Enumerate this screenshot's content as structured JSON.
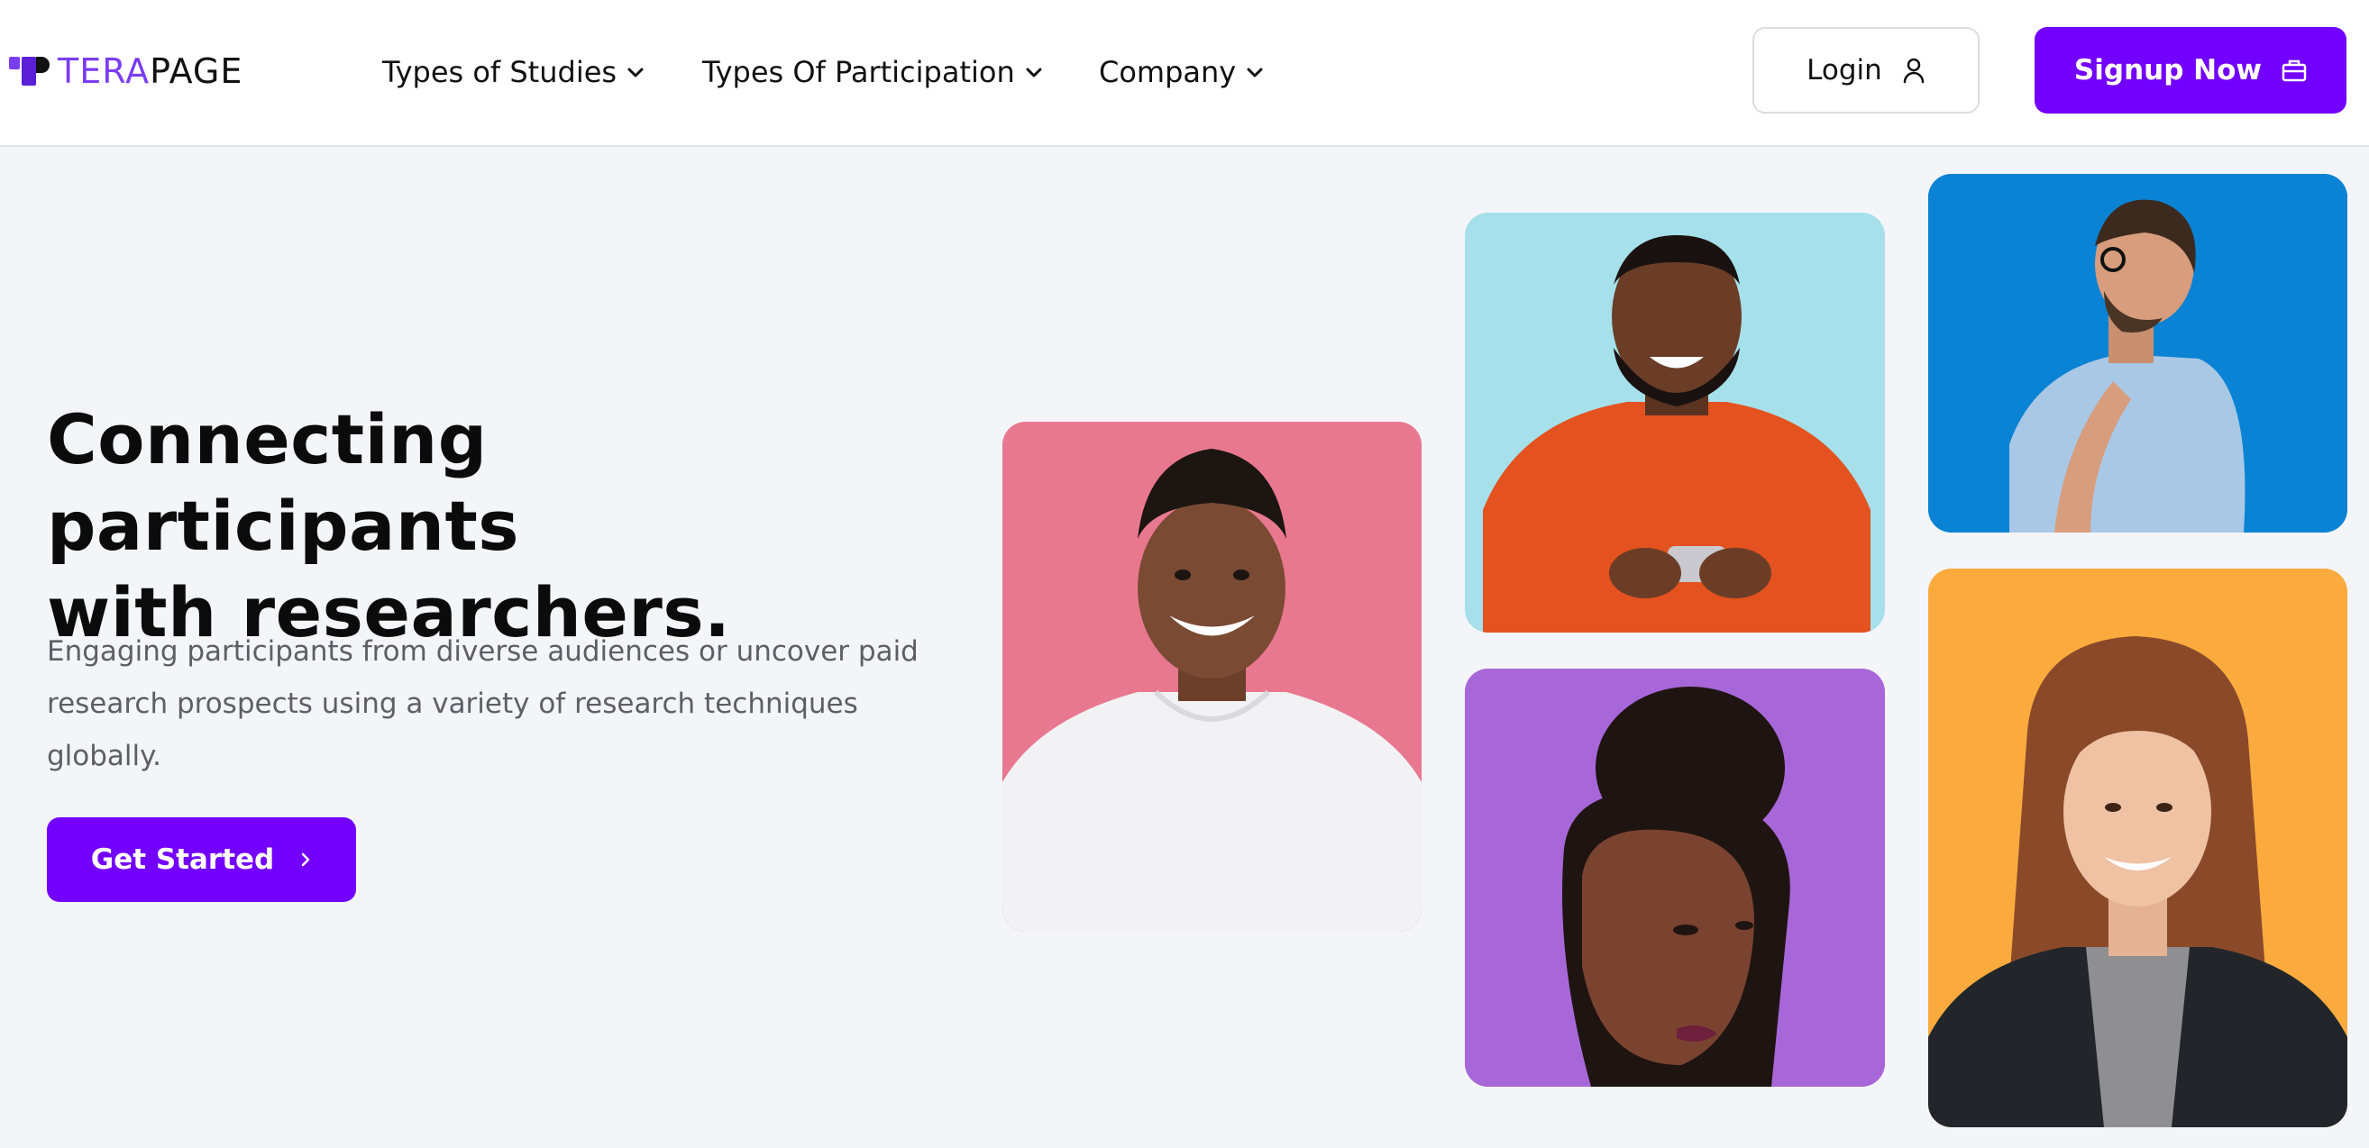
{
  "brand": {
    "name_part1": "TERA",
    "name_part2": "PAGE",
    "accent_color": "#7300ff",
    "logo_color": "#7b3df2"
  },
  "nav": {
    "items": [
      {
        "label": "Types of Studies",
        "icon": "chevron-down-icon"
      },
      {
        "label": "Types Of Participation",
        "icon": "chevron-down-icon"
      },
      {
        "label": "Company",
        "icon": "chevron-down-icon"
      }
    ]
  },
  "header_actions": {
    "login_label": "Login",
    "login_icon": "user-icon",
    "signup_label": "Signup Now",
    "signup_icon": "briefcase-icon"
  },
  "hero": {
    "title_line1": "Connecting participants",
    "title_line2": "with researchers.",
    "subtitle": "Engaging participants from diverse audiences or uncover paid research prospects using a variety of research techniques globally.",
    "cta_label": "Get Started",
    "cta_icon": "chevron-right-icon"
  },
  "gallery": {
    "photos": [
      {
        "name": "photo-smiling-man-white-tshirt",
        "background": "#e8788f"
      },
      {
        "name": "photo-man-orange-sweater-phone",
        "background": "#a6e0ea"
      },
      {
        "name": "photo-woman-hair-bun",
        "background": "#a867d8"
      },
      {
        "name": "photo-man-glasses-thinking",
        "background": "#0a83d4"
      },
      {
        "name": "photo-woman-leather-jacket",
        "background": "#fbab3e"
      }
    ]
  }
}
